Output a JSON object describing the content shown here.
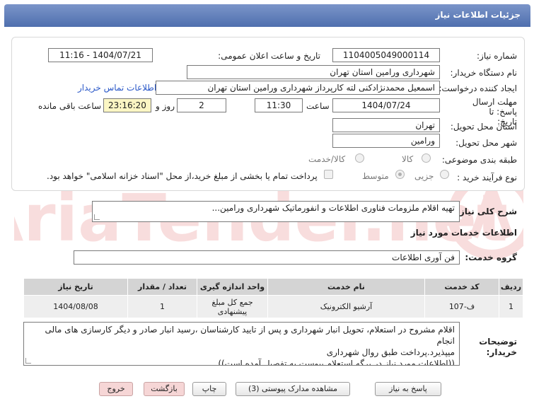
{
  "window": {
    "title": "جزئیات اطلاعات نیاز"
  },
  "form": {
    "need_number": {
      "label": "شماره نیاز:",
      "value": "1104005049000114"
    },
    "announce_datetime": {
      "label": "تاریخ و ساعت اعلان عمومی:",
      "value": "1404/07/21 - 11:16"
    },
    "buyer_org": {
      "label": "نام دستگاه خریدار:",
      "value": "شهرداری ورامین استان تهران"
    },
    "requester": {
      "label": "ایجاد کننده درخواست:",
      "value": "اسمعیل محمدنژادکنی لته کارپرداز شهرداری ورامین استان تهران",
      "contact_link": "اطلاعات تماس خریدار"
    },
    "deadline": {
      "label": "مهلت ارسال پاسخ: تا تاریخ:",
      "date": "1404/07/24",
      "time_label": "ساعت",
      "time": "11:30",
      "days": "2",
      "days_label": "روز و",
      "remaining": "23:16:20",
      "remaining_label": "ساعت باقی مانده"
    },
    "province": {
      "label": "استان محل تحویل:",
      "value": "تهران"
    },
    "city": {
      "label": "شهر محل تحویل:",
      "value": "ورامین"
    },
    "category": {
      "label": "طبقه بندی موضوعی:",
      "options": [
        "کالا",
        "کالا/خدمت"
      ]
    },
    "purchase_type": {
      "label": "نوع فرآیند خرید :",
      "options": [
        "جزیی",
        "متوسط"
      ],
      "selected": "متوسط",
      "treasury_note": "پرداخت تمام یا بخشی از مبلغ خرید،از محل \"اسناد خزانه اسلامی\" خواهد بود."
    }
  },
  "summary": {
    "label": "شرح کلی نیاز:",
    "value": "تهیه اقلام ملزومات فناوری اطلاعات و انفورماتیک شهرداری ورامین..."
  },
  "services": {
    "title": "اطلاعات خدمات مورد نیاز",
    "group_label": "گروه خدمت:",
    "group_value": "فن آوری اطلاعات",
    "table": {
      "headers": [
        "ردیف",
        "کد خدمت",
        "نام خدمت",
        "واحد اندازه گیری",
        "تعداد / مقدار",
        "تاریخ نیاز"
      ],
      "rows": [
        {
          "row": "1",
          "code": "ف-107",
          "name": "آرشیو الکترونیک",
          "unit": "جمع کل مبلغ پیشنهادی",
          "qty": "1",
          "date": "1404/08/08"
        }
      ]
    }
  },
  "buyer_notes": {
    "label": "توضیحات خریدار:",
    "lines": [
      "اقلام مشروح در استعلام، تحویل انبار شهرداری و پس از تایید کارشناسان ،رسید انبار صادر و دیگر کارسازی های مالی انجام",
      "میپذیرد.پرداخت طبق روال شهرداری",
      "((اطلاعات مورد نیاز در برگه استعلام پیوست به تفصیل آمده است))"
    ]
  },
  "buttons": {
    "reply": "پاسخ به نیاز",
    "attachments": "مشاهده مدارک پیوستی (3)",
    "print": "چاپ",
    "back": "بازگشت",
    "exit": "خروج"
  },
  "watermark": {
    "brand": "AriaTender.net"
  },
  "colors": {
    "title_bar": "#5a78b6",
    "link": "#2a58c8",
    "remaining_bg": "#fbf6c4",
    "exit_bg": "#f6d6d6"
  }
}
